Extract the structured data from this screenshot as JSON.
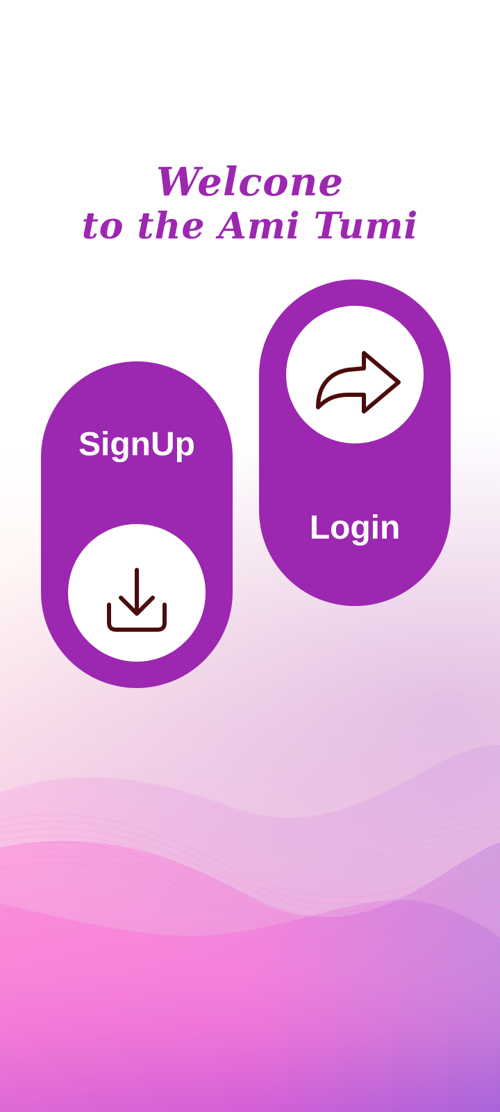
{
  "welcome": {
    "line1": "Welcone",
    "line2": "to the Ami Tumi"
  },
  "buttons": {
    "signup_label": "SignUp",
    "login_label": "Login"
  },
  "icons": {
    "signup": "download-icon",
    "login": "share-arrow-icon"
  },
  "colors": {
    "primary": "#9c27b0",
    "icon_stroke": "#4a0c0c"
  }
}
